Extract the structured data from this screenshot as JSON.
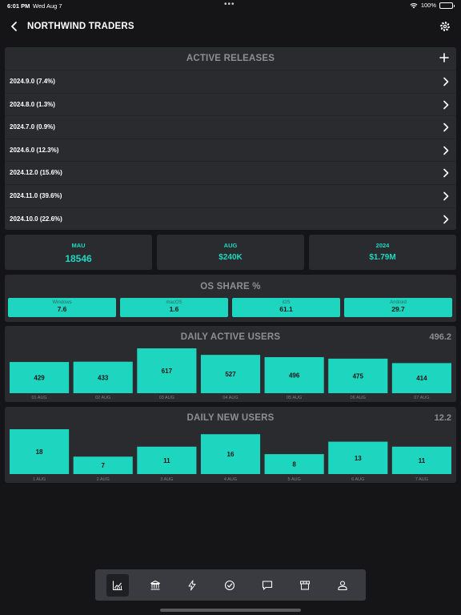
{
  "status_bar": {
    "time": "6:01 PM",
    "date": "Wed Aug 7",
    "dots": "•••",
    "battery": "100%"
  },
  "nav": {
    "title": "NORTHWIND TRADERS"
  },
  "releases": {
    "title": "ACTIVE RELEASES",
    "items": [
      {
        "label": "2024.9.0 (7.4%)"
      },
      {
        "label": "2024.8.0 (1.3%)"
      },
      {
        "label": "2024.7.0 (0.9%)"
      },
      {
        "label": "2024.6.0 (12.3%)"
      },
      {
        "label": "2024.12.0 (15.6%)"
      },
      {
        "label": "2024.11.0 (39.6%)"
      },
      {
        "label": "2024.10.0 (22.6%)"
      }
    ]
  },
  "stats": [
    {
      "key": "MAU",
      "value": "18546"
    },
    {
      "key": "AUG",
      "value": "$240K"
    },
    {
      "key": "2024",
      "value": "$1.79M"
    }
  ],
  "os_share": {
    "title": "OS SHARE %",
    "items": [
      {
        "name": "Windows",
        "value": "7.6"
      },
      {
        "name": "macOS",
        "value": "1.6"
      },
      {
        "name": "iOS",
        "value": "61.1"
      },
      {
        "name": "Android",
        "value": "29.7"
      }
    ]
  },
  "daily_active_users": {
    "title": "DAILY ACTIVE USERS",
    "average": "496.2"
  },
  "daily_new_users": {
    "title": "DAILY NEW USERS",
    "average": "12.2"
  },
  "chart_data": [
    {
      "type": "bar",
      "title": "DAILY ACTIVE USERS",
      "categories": [
        "01 AUG",
        "02 AUG",
        "03 AUG",
        "04 AUG",
        "05 AUG",
        "06 AUG",
        "07 AUG"
      ],
      "values": [
        429,
        433,
        617,
        527,
        496,
        475,
        414
      ],
      "ylim": [
        0,
        617
      ],
      "color": "#1ed6c0",
      "grid": false
    },
    {
      "type": "bar",
      "title": "DAILY NEW USERS",
      "categories": [
        "1 AUG",
        "2 AUG",
        "3 AUG",
        "4 AUG",
        "5 AUG",
        "6 AUG",
        "7 AUG"
      ],
      "values": [
        18,
        7,
        11,
        16,
        8,
        13,
        11
      ],
      "ylim": [
        0,
        18
      ],
      "color": "#1ed6c0",
      "grid": false
    }
  ],
  "tabs": [
    {
      "icon": "analytics-icon",
      "active": true
    },
    {
      "icon": "bank-icon",
      "active": false
    },
    {
      "icon": "lightning-icon",
      "active": false
    },
    {
      "icon": "check-circle-icon",
      "active": false
    },
    {
      "icon": "chat-icon",
      "active": false
    },
    {
      "icon": "store-icon",
      "active": false
    },
    {
      "icon": "user-icon",
      "active": false
    }
  ],
  "colors": {
    "accent": "#1ed6c0",
    "background": "#151518",
    "card": "#2a2b2f"
  }
}
